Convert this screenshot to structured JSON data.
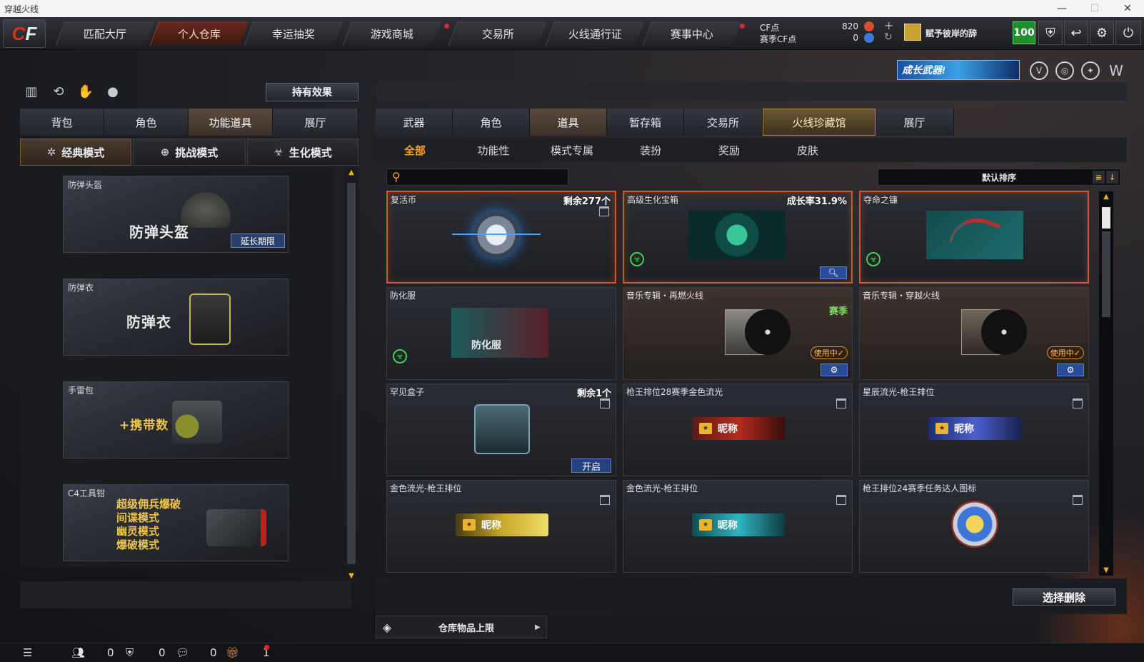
{
  "window": {
    "title": "穿越火线",
    "min": "—",
    "max": "☐",
    "close": "✕"
  },
  "logo": {
    "c": "C",
    "f": "F"
  },
  "nav": {
    "tabs": [
      "匹配大厅",
      "个人仓库",
      "幸运抽奖",
      "游戏商城",
      "交易所",
      "火线通行证",
      "赛事中心"
    ],
    "active_index": 1
  },
  "currency": {
    "cf_label": "CF点",
    "cf_value": "820",
    "season_label": "赛季CF点",
    "season_value": "0",
    "add": "+",
    "refresh": "↻"
  },
  "user": {
    "name": "赋予彼岸的辞",
    "level": "100"
  },
  "header_icons": [
    "shield-icon",
    "return-icon",
    "gear-icon",
    "power-icon"
  ],
  "banner": {
    "text": "成长武器!"
  },
  "left": {
    "effect_button": "持有效果",
    "tabs": [
      "背包",
      "角色",
      "功能道具",
      "展厅"
    ],
    "active_tab": 2,
    "modes": [
      "经典模式",
      "挑战模式",
      "生化模式"
    ],
    "active_mode": 0,
    "items": [
      {
        "name": "防弹头盔",
        "big": "防弹头盔",
        "action": "延长期限"
      },
      {
        "name": "防弹衣",
        "big": "防弹衣"
      },
      {
        "name": "手雷包",
        "big": "+携带数"
      },
      {
        "name": "C4工具钳",
        "lines": [
          "超级佣兵爆破",
          "间谍模式",
          "幽灵模式",
          "爆破模式"
        ]
      }
    ]
  },
  "right": {
    "tabs": [
      "武器",
      "角色",
      "道具",
      "暂存箱",
      "交易所",
      "火线珍藏馆",
      "展厅"
    ],
    "active_tab": 2,
    "special_tab": 5,
    "subtabs": [
      "全部",
      "功能性",
      "模式专属",
      "装扮",
      "奖励",
      "皮肤"
    ],
    "active_subtab": 0,
    "search_placeholder": "",
    "sort_label": "默认排序",
    "items": [
      {
        "name": "复活币",
        "extra": "剩余277个"
      },
      {
        "name": "高级生化宝箱",
        "extra": "成长率31.9%"
      },
      {
        "name": "夺命之镰"
      },
      {
        "name": "防化服",
        "art_text": "防化服"
      },
      {
        "name": "音乐专辑・再燃火线",
        "tag": "赛季",
        "status": "使用中✓"
      },
      {
        "name": "音乐专辑・穿越火线",
        "status": "使用中✓"
      },
      {
        "name": "罕见盒子",
        "extra": "剩余1个",
        "action": "开启"
      },
      {
        "name": "枪王排位28赛季金色流光",
        "plate": "昵称"
      },
      {
        "name": "星辰流光-枪王排位",
        "plate": "昵称"
      },
      {
        "name": "金色流光-枪王排位",
        "plate": "昵称"
      },
      {
        "name": "金色流光-枪王排位",
        "plate": "昵称"
      },
      {
        "name": "枪王排位24赛季任务达人图标"
      }
    ],
    "select_delete": "选择删除",
    "capacity_label": "仓库物品上限"
  },
  "statusbar": {
    "count1": "0",
    "count2": "0",
    "count3": "0",
    "count4": "1"
  }
}
